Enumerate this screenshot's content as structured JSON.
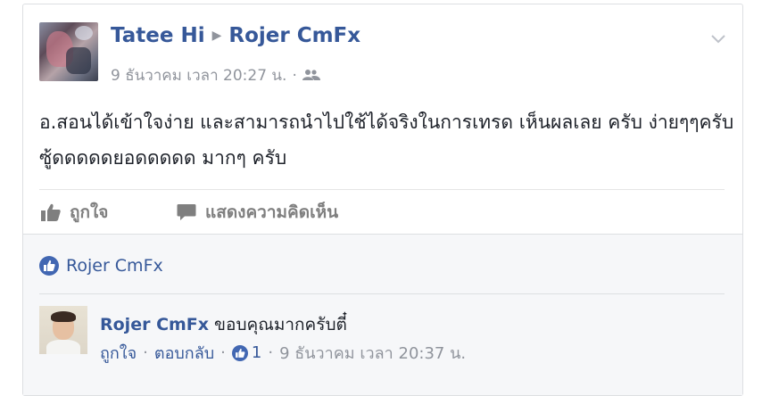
{
  "post": {
    "author": "Tatee Hi",
    "target": "Rojer CmFx",
    "timestamp": "9 ธันวาคม เวลา 20:27 น.",
    "audience_icon": "friends-icon",
    "text": "อ.สอนได้เข้าใจง่าย และสามารถนำไปใช้ได้จริงในการเทรด เห็นผลเลย ครับ ง่ายๆๆครับ ซู้ดดดดดยอดดดดด มากๆ ครับ",
    "options_icon": "chevron-down-icon"
  },
  "actions": {
    "like_label": "ถูกใจ",
    "comment_label": "แสดงความคิดเห็น"
  },
  "likes": {
    "liked_by": "Rojer CmFx"
  },
  "comment": {
    "author": "Rojer CmFx",
    "text": "ขอบคุณมากครับตี๋",
    "like_label": "ถูกใจ",
    "reply_label": "ตอบกลับ",
    "reaction_count": "1",
    "timestamp": "9 ธันวาคม เวลา 20:37 น."
  },
  "colors": {
    "link": "#365899",
    "meta": "#90949c",
    "like_blue": "#4267b2",
    "comments_bg": "#f6f7f9"
  }
}
